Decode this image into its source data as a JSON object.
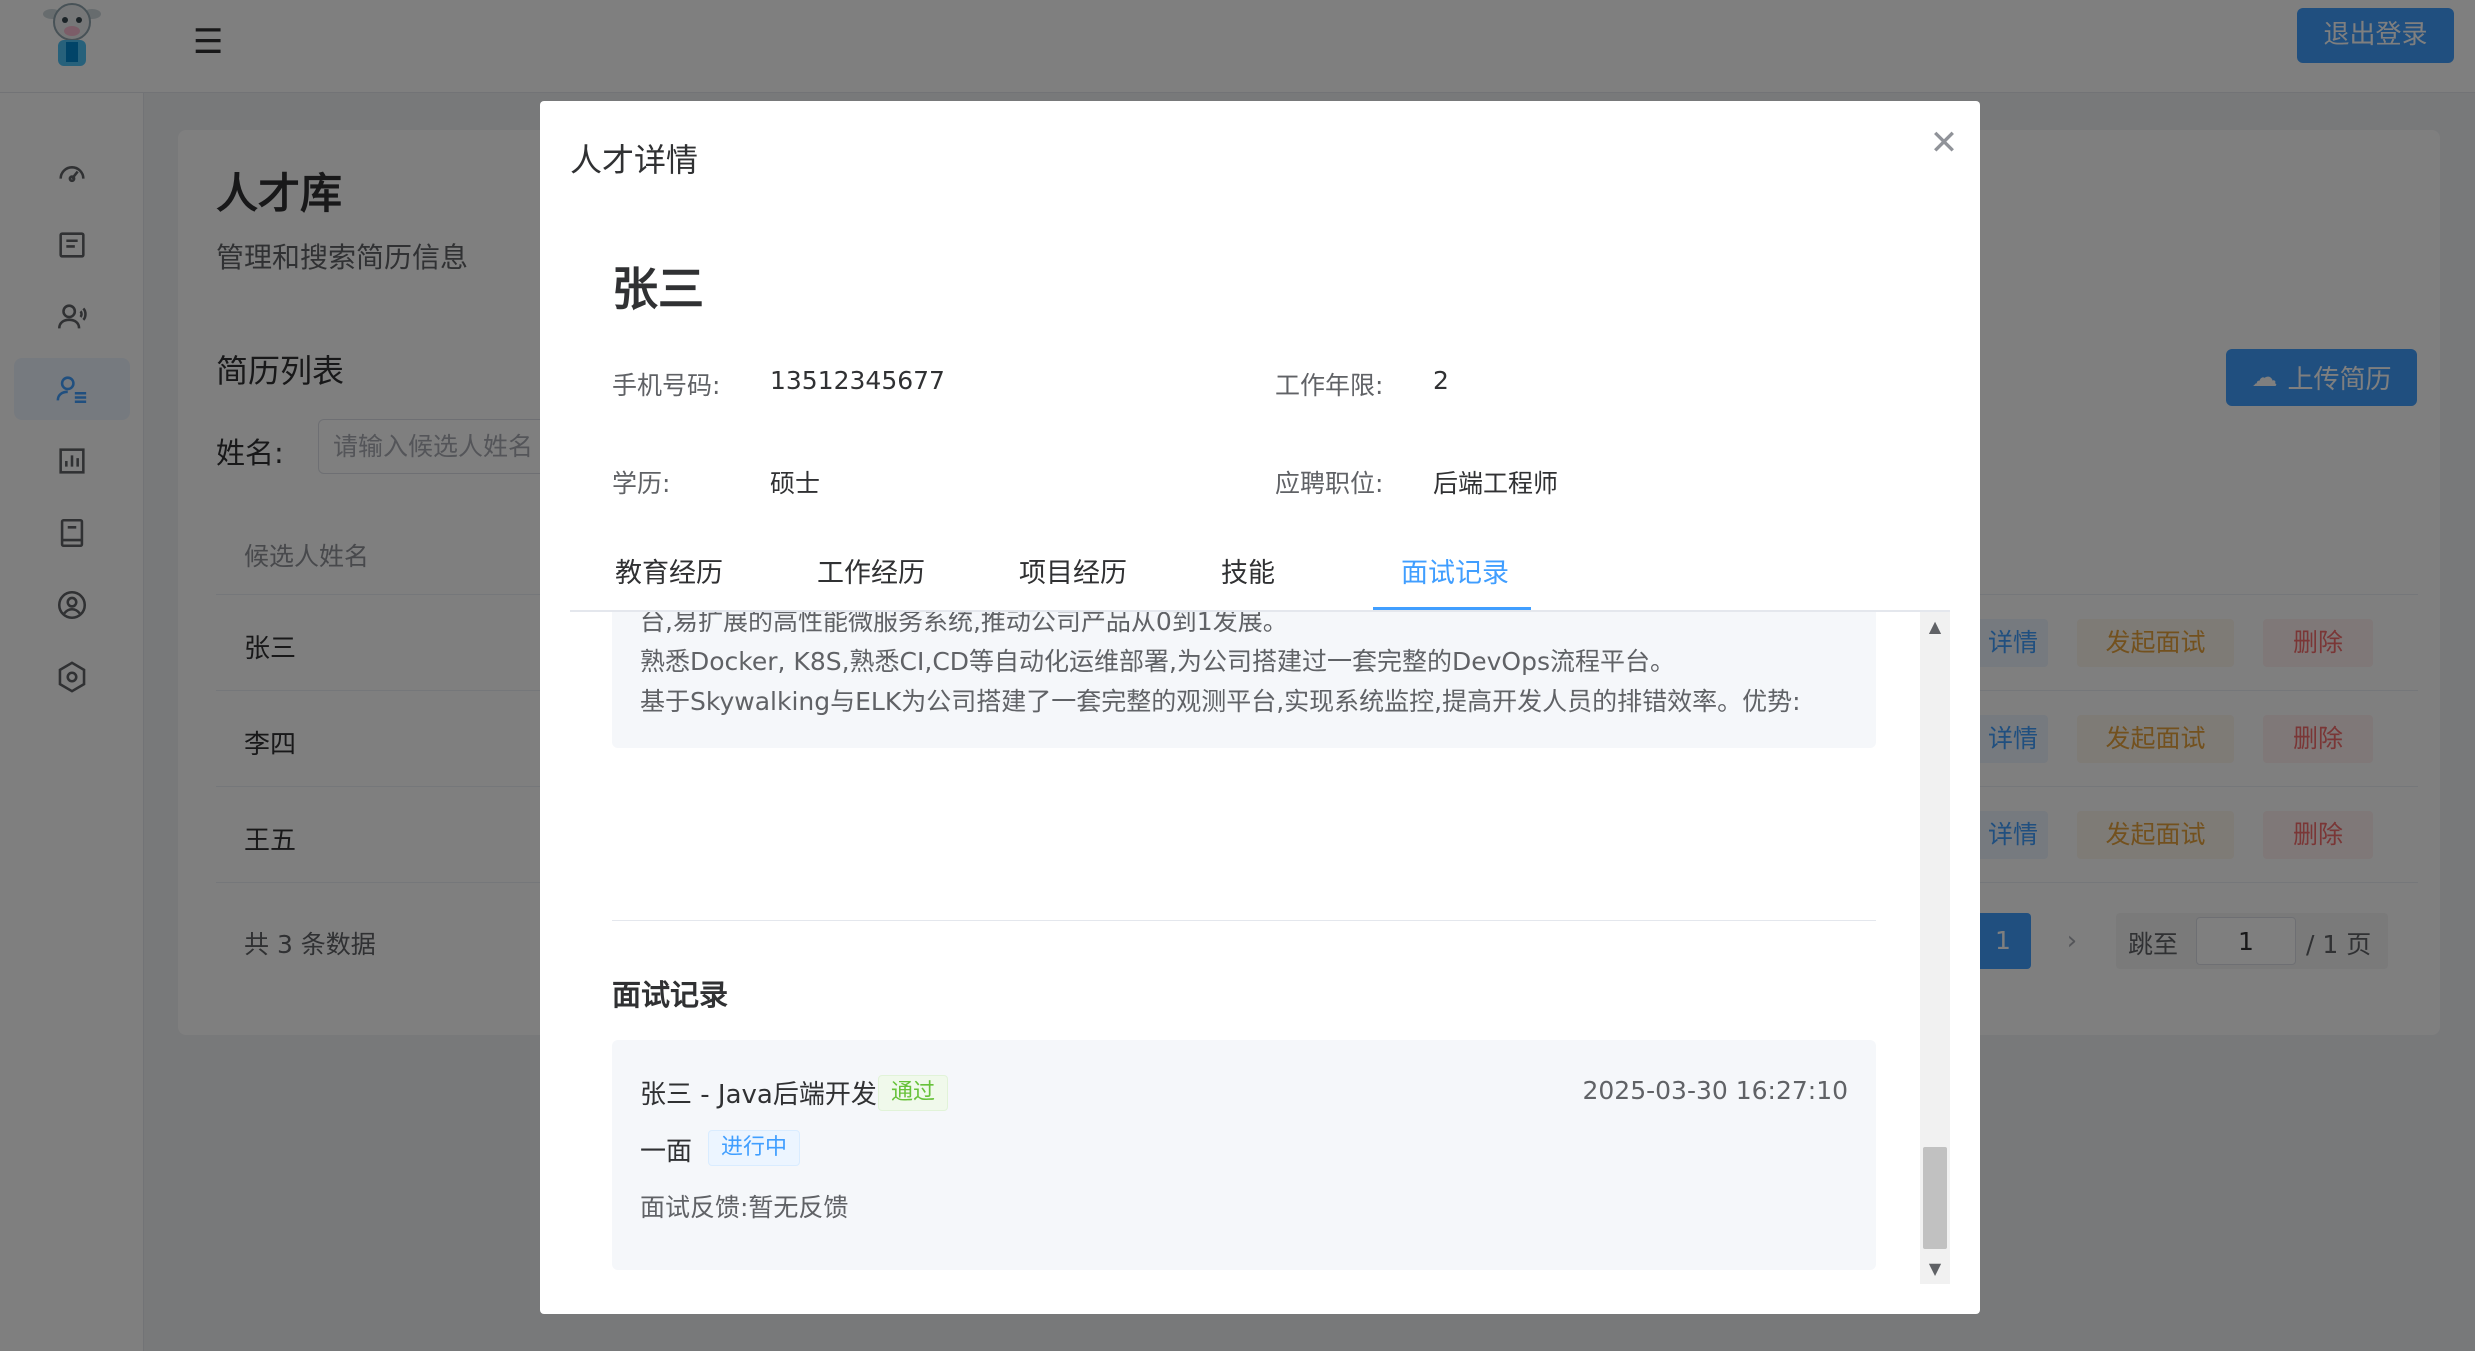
{
  "header": {
    "logout_label": "退出登录"
  },
  "page": {
    "title": "人才库",
    "subtitle": "管理和搜索简历信息",
    "list_title": "简历列表",
    "upload_label": "上传简历",
    "filter_label": "姓名:",
    "filter_placeholder": "请输入候选人姓名",
    "column_name": "候选人姓名",
    "rows": [
      {
        "name": "张三",
        "detail": "详情",
        "interview": "发起面试",
        "delete": "删除"
      },
      {
        "name": "李四",
        "detail": "详情",
        "interview": "发起面试",
        "delete": "删除"
      },
      {
        "name": "王五",
        "detail": "详情",
        "interview": "发起面试",
        "delete": "删除"
      }
    ],
    "total": "共 3 条数据",
    "pagination": {
      "current": "1",
      "jump_label": "跳至",
      "jump_value": "1",
      "total_pages": "/ 1 页"
    }
  },
  "sidebar": {
    "icons": [
      "dashboard-icon",
      "document-icon",
      "user-voice-icon",
      "user-list-icon",
      "chart-icon",
      "book-icon",
      "user-circle-icon",
      "settings-icon"
    ],
    "active_index": 3
  },
  "dialog": {
    "title": "人才详情",
    "candidate_name": "张三",
    "phone_label": "手机号码:",
    "phone": "13512345677",
    "years_label": "工作年限:",
    "years": "2",
    "degree_label": "学历:",
    "degree": "硕士",
    "position_label": "应聘职位:",
    "position": "后端工程师",
    "tabs": [
      "教育经历",
      "工作经历",
      "项目经历",
      "技能",
      "面试记录"
    ],
    "active_tab": "面试记录",
    "experience_lines": [
      "台,易扩展的高性能微服务系统,推动公司产品从0到1发展。",
      "熟悉Docker, K8S,熟悉CI,CD等自动化运维部署,为公司搭建过一套完整的DevOps流程平台。",
      "基于Skywalking与ELK为公司搭建了一套完整的观测平台,实现系统监控,提高开发人员的排错效率。优势:"
    ],
    "interview_section_title": "面试记录",
    "interview_record": {
      "title": "张三 - Java后端开发",
      "result_tag": "通过",
      "time": "2025-03-30 16:27:10",
      "round": "一面",
      "status_tag": "进行中",
      "feedback": "面试反馈:暂无反馈"
    }
  },
  "colors": {
    "primary": "#409eff",
    "success": "#67c23a",
    "warning": "#e6a23c",
    "danger": "#f56c6c",
    "overlay": "rgba(0,0,0,0.5)"
  }
}
